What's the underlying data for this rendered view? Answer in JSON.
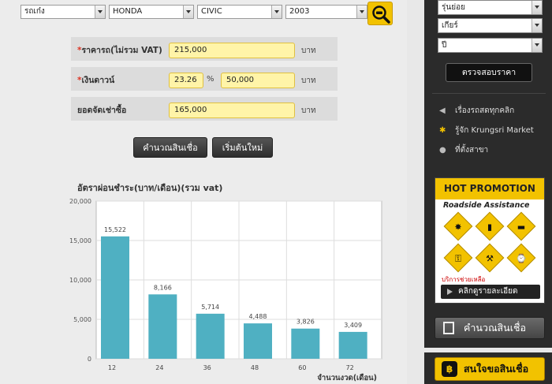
{
  "filters": {
    "type": "รถเก๋ง",
    "brand": "HONDA",
    "model": "CIVIC",
    "year": "2003"
  },
  "form": {
    "price_label": "ราคารถ(ไม่รวม VAT)",
    "price_value": "215,000",
    "down_label": "เงินดาวน์",
    "down_percent": "23.26",
    "percent_sign": "%",
    "down_value": "50,000",
    "finance_label": "ยอดจัดเช่าซื้อ",
    "finance_value": "165,000",
    "required_mark": "*",
    "unit": "บาท"
  },
  "buttons": {
    "calculate": "คำนวณสินเชื่อ",
    "reset": "เริ่มต้นใหม่"
  },
  "chart_data": {
    "type": "bar",
    "title": "อัตราผ่อนชำระ(บาท/เดือน)(รวม vat)",
    "xlabel": "จำนวนงวด(เดือน)",
    "ylabel": "",
    "categories": [
      "12",
      "24",
      "36",
      "48",
      "60",
      "72"
    ],
    "values": [
      15522,
      8166,
      5714,
      4488,
      3826,
      3409
    ],
    "value_labels": [
      "15,522",
      "8,166",
      "5,714",
      "4,488",
      "3,826",
      "3,409"
    ],
    "y_ticks": [
      "0",
      "5,000",
      "10,000",
      "15,000",
      "20,000"
    ],
    "ylim": [
      0,
      20000
    ],
    "grid": true,
    "bar_color": "#4fb0c2"
  },
  "sidebar": {
    "submodel": "รุ่นย่อย",
    "gear": "เกียร์",
    "year": "ปี",
    "check_price": "ตรวจสอบราคา",
    "links": [
      {
        "icon": "megaphone-icon",
        "label": "เรื่องรถสดทุกคลิก"
      },
      {
        "icon": "krungsri-logo-icon",
        "label": "รู้จัก Krungsri Market"
      },
      {
        "icon": "location-pin-icon",
        "label": "ที่ตั้งสาขา"
      }
    ],
    "promo_title": "HOT PROMOTION",
    "promo_subtitle": "Roadside Assistance",
    "promo_banner": "บริการช่วยเหลือ",
    "promo_button": "คลิกดูรายละเอียด",
    "calc_button": "คำนวณสินเชื่อ",
    "loan_button": "สนใจขอสินเชื่อ"
  },
  "colors": {
    "accent": "#f2c200",
    "sidebar_bg": "#2b2b2b",
    "input_bg": "#fff4a8"
  }
}
